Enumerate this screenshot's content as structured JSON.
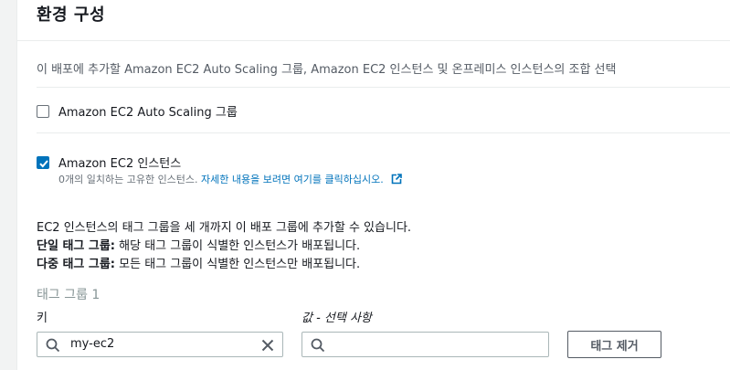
{
  "section": {
    "title": "환경 구성",
    "description": "이 배포에 추가할 Amazon EC2 Auto Scaling 그룹, Amazon EC2 인스턴스 및 온프레미스 인스턴스의 조합 선택"
  },
  "options": {
    "autoscaling": {
      "label": "Amazon EC2 Auto Scaling 그룹",
      "checked": false
    },
    "ec2": {
      "label": "Amazon EC2 인스턴스",
      "checked": true,
      "sub_text": "0개의 일치하는 고유한 인스턴스.",
      "link_text": "자세한 내용을 보려면 여기를 클릭하십시오.",
      "link_icon": "external-link-icon"
    }
  },
  "info": {
    "line1": "EC2 인스턴스의 태그 그룹을 세 개까지 이 배포 그룹에 추가할 수 있습니다.",
    "single_label": "단일 태그 그룹:",
    "single_text": " 해당 태그 그룹이 식별한 인스턴스가 배포됩니다.",
    "multi_label": "다중 태그 그룹:",
    "multi_text": " 모든 태그 그룹이 식별한 인스턴스만 배포됩니다."
  },
  "tag_group": {
    "title": "태그 그룹 1",
    "key_label": "키",
    "key_value": "my-ec2",
    "value_label": "값 - 선택 사항",
    "value_value": "",
    "remove_label": "태그 제거"
  },
  "colors": {
    "accent": "#0073bb",
    "border": "#aab7b8",
    "muted": "#687078"
  },
  "icons": {
    "search": "search-icon",
    "clear": "close-icon",
    "check": "checkmark-icon"
  }
}
